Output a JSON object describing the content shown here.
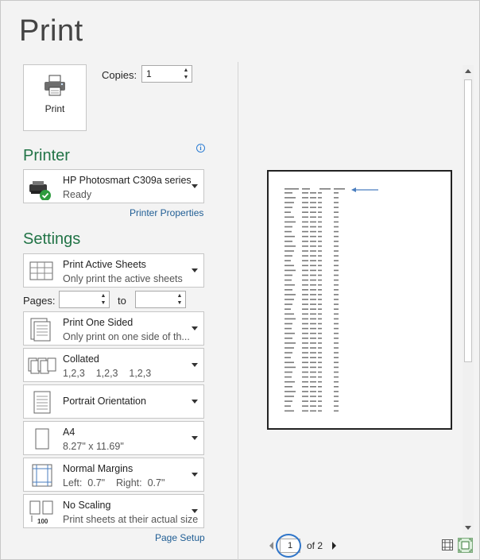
{
  "header": {
    "title": "Print"
  },
  "print_button": {
    "label": "Print",
    "icon": "printer-icon"
  },
  "copies": {
    "label": "Copies:",
    "value": "1"
  },
  "printer": {
    "section_title": "Printer",
    "name": "HP Photosmart C309a series",
    "status": "Ready",
    "properties_link": "Printer Properties"
  },
  "settings": {
    "section_title": "Settings",
    "what": {
      "main": "Print Active Sheets",
      "sub": "Only print the active sheets"
    },
    "pages": {
      "label": "Pages:",
      "from": "",
      "to_label": "to",
      "to": ""
    },
    "sides": {
      "main": "Print One Sided",
      "sub": "Only print on one side of th..."
    },
    "collation": {
      "main": "Collated",
      "sub": "1,2,3    1,2,3    1,2,3"
    },
    "orientation": {
      "main": "Portrait Orientation"
    },
    "paper": {
      "main": "A4",
      "sub": "8.27\" x 11.69\""
    },
    "margins": {
      "main": "Normal Margins",
      "sub": "Left:  0.7\"    Right:  0.7\""
    },
    "scaling": {
      "main": "No Scaling",
      "sub": "Print sheets at their actual size",
      "badge": "100"
    },
    "page_setup_link": "Page Setup"
  },
  "preview": {
    "current_page": "1",
    "total_label": "of 2",
    "arrow_color": "#4a7ebf"
  },
  "colors": {
    "accent": "#217346",
    "link": "#1f5d94",
    "highlight": "#2f75c9"
  }
}
